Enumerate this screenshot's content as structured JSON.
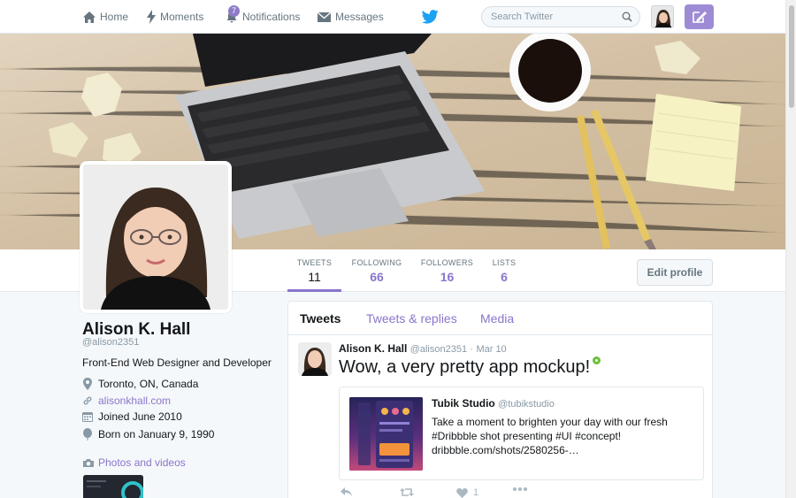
{
  "nav": {
    "items": [
      {
        "label": "Home",
        "icon": "home-icon"
      },
      {
        "label": "Moments",
        "icon": "lightning-icon"
      },
      {
        "label": "Notifications",
        "icon": "bell-icon",
        "badge": "7"
      },
      {
        "label": "Messages",
        "icon": "envelope-icon"
      }
    ],
    "logo": "twitter-bird-icon",
    "search_placeholder": "Search Twitter",
    "compose_icon": "compose-icon"
  },
  "colors": {
    "accent": "#8a75cc",
    "compose_button": "#9e8bd6",
    "twitter_blue": "#1da1f2",
    "badge": "#8f7cc7"
  },
  "stats": [
    {
      "label": "TWEETS",
      "value": "11",
      "active": true
    },
    {
      "label": "FOLLOWING",
      "value": "66",
      "active": false
    },
    {
      "label": "FOLLOWERS",
      "value": "16",
      "active": false
    },
    {
      "label": "LISTS",
      "value": "6",
      "active": false
    }
  ],
  "edit_profile_label": "Edit profile",
  "profile": {
    "name": "Alison K. Hall",
    "handle": "@alison2351",
    "bio": "Front-End Web Designer and Developer",
    "location": "Toronto, ON, Canada",
    "website": "alisonkhall.com",
    "joined": "Joined June 2010",
    "birthday": "Born on January 9, 1990",
    "photos_label": "Photos and videos"
  },
  "timeline": {
    "tabs": [
      "Tweets",
      "Tweets & replies",
      "Media"
    ],
    "active_tab": "Tweets"
  },
  "tweet": {
    "author": "Alison K. Hall",
    "handle": "@alison2351",
    "separator": "·",
    "date": "Mar 10",
    "text": "Wow, a very pretty app mockup!",
    "card": {
      "author": "Tubik Studio",
      "handle": "@tubikstudio",
      "text": "Take a moment to brighten your day with our fresh #Dribbble shot presenting #UI #concept! dribbble.com/shots/2580256-…"
    },
    "likes": "1"
  }
}
